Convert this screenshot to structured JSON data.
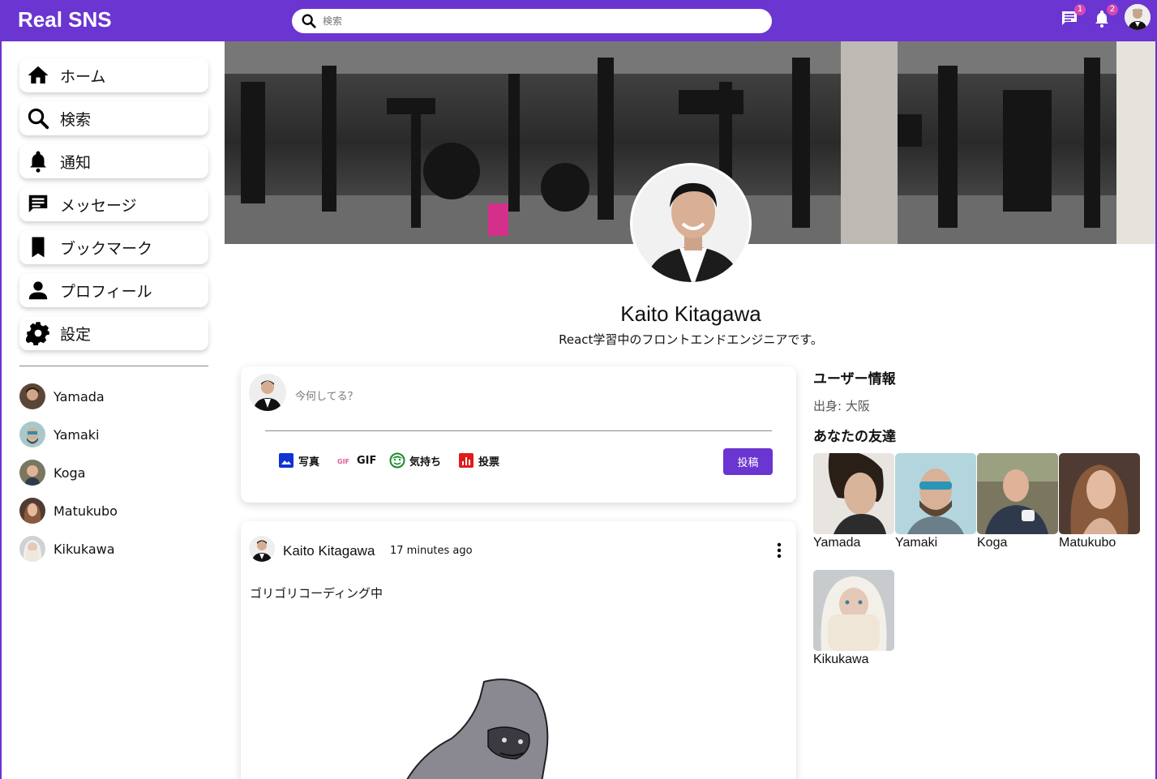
{
  "app": {
    "title": "Real SNS"
  },
  "search": {
    "placeholder": "検索"
  },
  "topbar": {
    "message_badge": "1",
    "notification_badge": "2"
  },
  "sidebar": {
    "items": [
      {
        "label": "ホーム",
        "icon": "home-icon"
      },
      {
        "label": "検索",
        "icon": "search-icon"
      },
      {
        "label": "通知",
        "icon": "bell-icon"
      },
      {
        "label": "メッセージ",
        "icon": "chat-icon"
      },
      {
        "label": "ブックマーク",
        "icon": "bookmark-icon"
      },
      {
        "label": "プロフィール",
        "icon": "person-icon"
      },
      {
        "label": "設定",
        "icon": "gear-icon"
      }
    ],
    "friends": [
      {
        "name": "Yamada"
      },
      {
        "name": "Yamaki"
      },
      {
        "name": "Koga"
      },
      {
        "name": "Matukubo"
      },
      {
        "name": "Kikukawa"
      }
    ]
  },
  "profile": {
    "name": "Kaito Kitagawa",
    "description": "React学習中のフロントエンドエンジニアです。"
  },
  "share": {
    "placeholder": "今何してる？",
    "options": [
      {
        "label": "写真",
        "icon": "image-icon"
      },
      {
        "label": "GIF",
        "icon": "gif-icon"
      },
      {
        "label": "気持ち",
        "icon": "smile-icon"
      },
      {
        "label": "投票",
        "icon": "poll-icon"
      }
    ],
    "post_label": "投稿"
  },
  "post": {
    "username": "Kaito Kitagawa",
    "time": "17 minutes ago",
    "text": "ゴリゴリコーディング中"
  },
  "rightbar": {
    "user_info_title": "ユーザー情報",
    "origin": "出身: 大阪",
    "friends_title": "あなたの友達",
    "friends": [
      {
        "name": "Yamada"
      },
      {
        "name": "Yamaki"
      },
      {
        "name": "Koga"
      },
      {
        "name": "Matukubo"
      },
      {
        "name": "Kikukawa"
      }
    ]
  },
  "colors": {
    "accent": "#6a35d0",
    "badge": "#d24bb1"
  }
}
